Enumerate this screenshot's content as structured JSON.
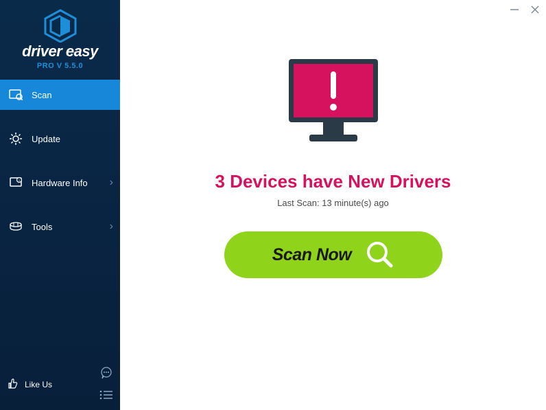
{
  "app": {
    "brand": "driver easy",
    "version": "PRO V 5.5.0"
  },
  "sidebar": {
    "items": [
      {
        "label": "Scan",
        "has_chevron": false,
        "active": true
      },
      {
        "label": "Update",
        "has_chevron": false,
        "active": false
      },
      {
        "label": "Hardware Info",
        "has_chevron": true,
        "active": false
      },
      {
        "label": "Tools",
        "has_chevron": true,
        "active": false
      }
    ],
    "like_us": "Like Us"
  },
  "main": {
    "headline": "3 Devices have New Drivers",
    "last_scan": "Last Scan: 13 minute(s) ago",
    "scan_button": "Scan Now"
  },
  "colors": {
    "accent": "#1687d9",
    "alert": "#d6125f",
    "action": "#8fd31a",
    "sidebar_bg": "#0a2a4a"
  }
}
